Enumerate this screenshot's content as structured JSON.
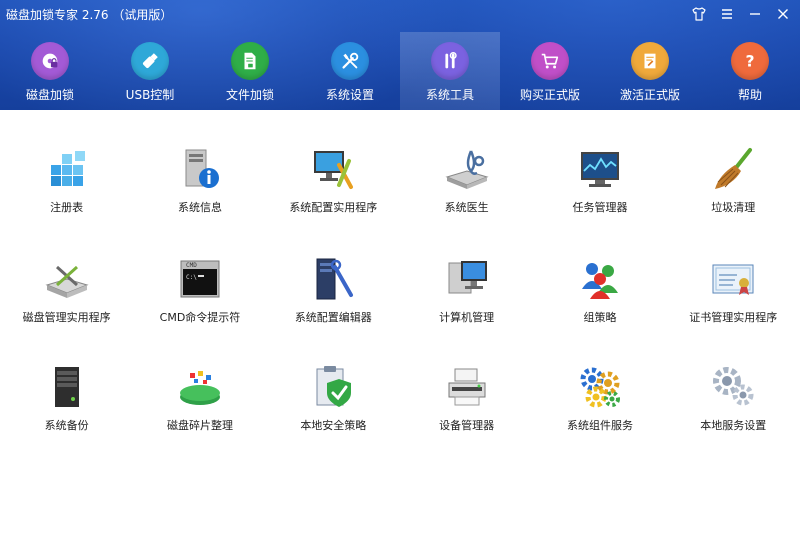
{
  "window": {
    "title": "磁盘加锁专家 2.76 （试用版）",
    "controls": [
      {
        "name": "skin-icon"
      },
      {
        "name": "menu-icon"
      },
      {
        "name": "minimize-icon"
      },
      {
        "name": "close-icon"
      }
    ]
  },
  "nav": {
    "active": "系统工具",
    "items": [
      {
        "label": "磁盘加锁",
        "icon": "disk-lock-icon",
        "color": "#a35ad6"
      },
      {
        "label": "USB控制",
        "icon": "usb-icon",
        "color": "#2ea8d8"
      },
      {
        "label": "文件加锁",
        "icon": "file-lock-icon",
        "color": "#2fae48"
      },
      {
        "label": "系统设置",
        "icon": "wrench-screwdriver-icon",
        "color": "#2b8fe0"
      },
      {
        "label": "系统工具",
        "icon": "tools-icon",
        "color": "#7b62e0"
      },
      {
        "label": "购买正式版",
        "icon": "cart-icon",
        "color": "#c04fc8"
      },
      {
        "label": "激活正式版",
        "icon": "activate-icon",
        "color": "#f0a93b"
      },
      {
        "label": "帮助",
        "icon": "help-icon",
        "color": "#ef6a3c"
      }
    ]
  },
  "tools": {
    "rows": [
      [
        {
          "label": "注册表",
          "icon": "registry-icon"
        },
        {
          "label": "系统信息",
          "icon": "system-info-icon"
        },
        {
          "label": "系统配置实用程序",
          "icon": "system-config-icon"
        },
        {
          "label": "系统医生",
          "icon": "system-doctor-icon"
        },
        {
          "label": "任务管理器",
          "icon": "task-manager-icon"
        },
        {
          "label": "垃圾清理",
          "icon": "broom-icon"
        }
      ],
      [
        {
          "label": "磁盘管理实用程序",
          "icon": "disk-management-icon"
        },
        {
          "label": "CMD命令提示符",
          "icon": "cmd-icon"
        },
        {
          "label": "系统配置编辑器",
          "icon": "config-editor-icon"
        },
        {
          "label": "计算机管理",
          "icon": "computer-management-icon"
        },
        {
          "label": "组策略",
          "icon": "group-policy-icon"
        },
        {
          "label": "证书管理实用程序",
          "icon": "certificate-icon"
        }
      ],
      [
        {
          "label": "系统备份",
          "icon": "backup-icon"
        },
        {
          "label": "磁盘碎片整理",
          "icon": "defrag-icon"
        },
        {
          "label": "本地安全策略",
          "icon": "security-policy-icon"
        },
        {
          "label": "设备管理器",
          "icon": "device-manager-icon"
        },
        {
          "label": "系统组件服务",
          "icon": "component-services-icon"
        },
        {
          "label": "本地服务设置",
          "icon": "local-services-icon"
        }
      ]
    ]
  }
}
